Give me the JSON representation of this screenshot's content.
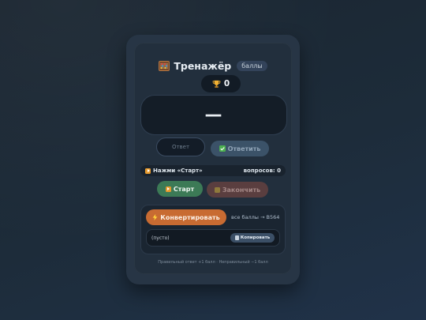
{
  "header": {
    "title": "Тренажёр",
    "tag": "баллы"
  },
  "score": {
    "icon": "trophy-icon",
    "value": "0"
  },
  "display": {
    "value": "—"
  },
  "answer": {
    "placeholder": "Ответ",
    "value": "",
    "button_label": "Ответить",
    "button_icon": "check-icon"
  },
  "status": {
    "message": "Нажми «Старт»",
    "questions_label": "вопросов: 0"
  },
  "controls": {
    "start_label": "Старт",
    "finish_label": "Закончить"
  },
  "convert": {
    "button_label": "Конвертировать",
    "button_icon": "lightning-icon",
    "hint": "все баллы → B564",
    "output": "(пусто)",
    "copy_label": "Копировать"
  },
  "footer": {
    "text": "Правильный ответ +1 балл · Неправильный −1 балл"
  },
  "colors": {
    "accent_orange": "#c86b32",
    "start_green": "#3c7a56",
    "finish_red": "#5a3e3f",
    "answer_blue": "#3b5268"
  }
}
